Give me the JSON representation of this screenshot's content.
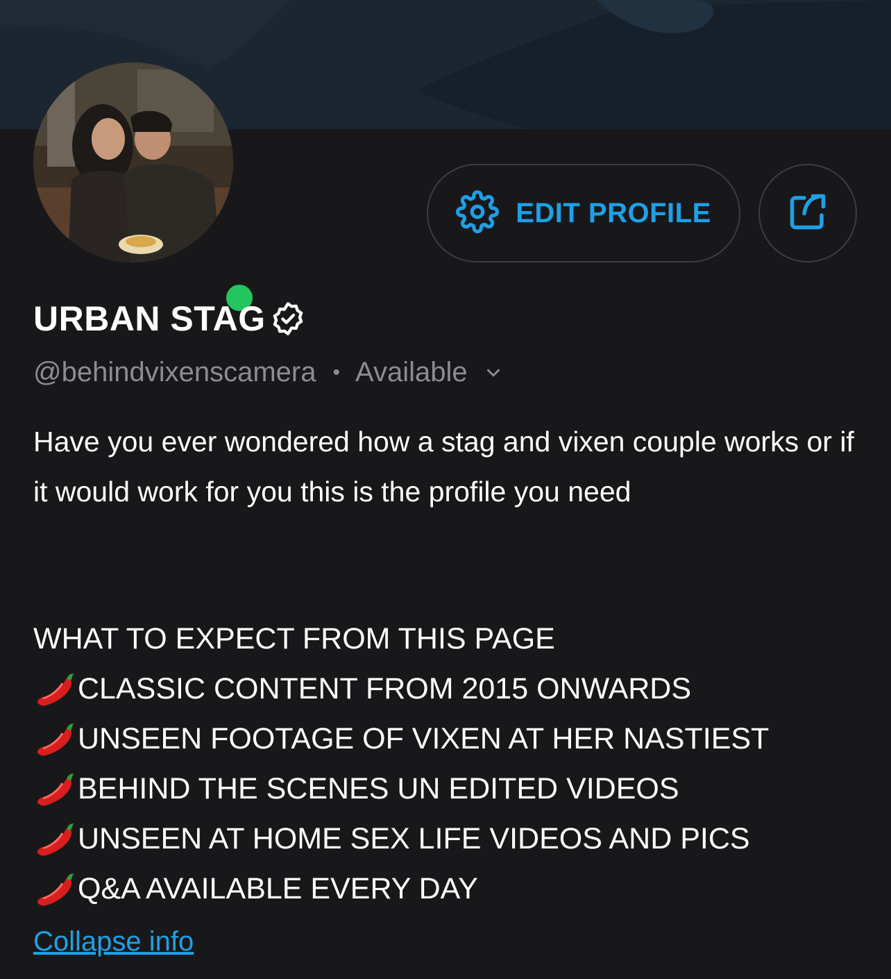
{
  "profile": {
    "name": "URBAN STAG",
    "handle": "@behindvixenscamera",
    "separator": "•",
    "status": "Available"
  },
  "actions": {
    "edit_label": "EDIT PROFILE"
  },
  "bio": {
    "intro": "Have you ever wondered how a stag and vixen couple works or if it would work for you this is the profile you need",
    "list_heading": "WHAT TO EXPECT FROM THIS PAGE",
    "items": [
      "CLASSIC CONTENT FROM 2015 ONWARDS",
      "UNSEEN FOOTAGE OF VIXEN AT HER NASTIEST",
      "BEHIND THE SCENES UN EDITED VIDEOS",
      "UNSEEN AT HOME SEX LIFE VIDEOS AND PICS",
      "Q&A AVAILABLE EVERY DAY"
    ]
  },
  "footer": {
    "collapse_label": "Collapse info"
  },
  "colors": {
    "background": "#18181a",
    "accent": "#1ea0e6",
    "online": "#23c55e",
    "muted_text": "#8a8d93"
  },
  "icons": {
    "edit": "gear-icon",
    "share": "share-icon",
    "verified": "verified-badge-icon",
    "status_dropdown": "chevron-down-icon",
    "list_bullet": "chili-pepper-icon"
  }
}
